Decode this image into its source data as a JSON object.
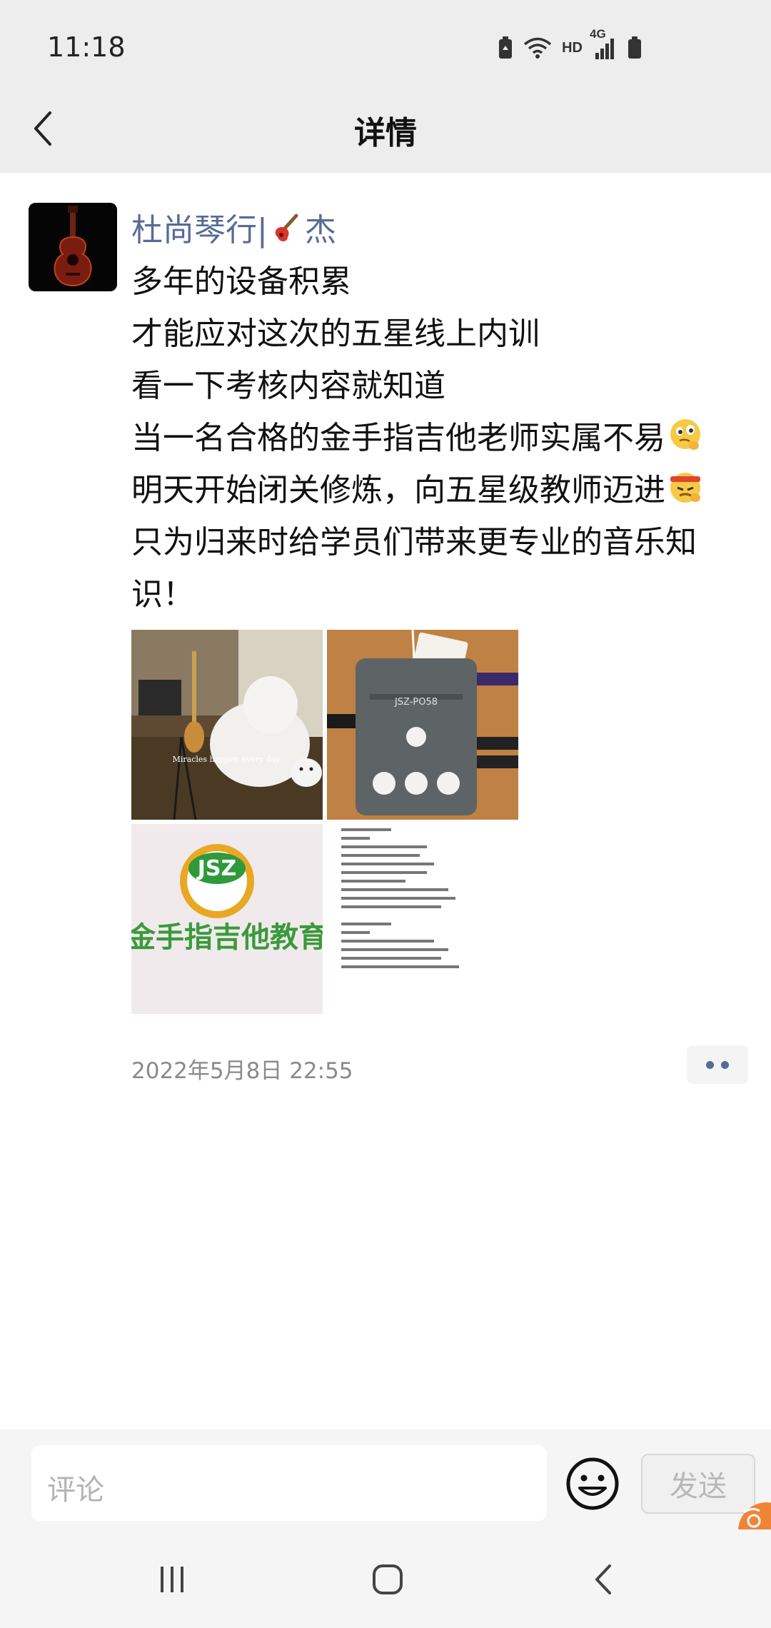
{
  "status": {
    "time": "11:18",
    "network_label": "HD",
    "signal_label": "4G",
    "icons": [
      "battery-saver-icon",
      "wifi-icon",
      "cellular-signal-icon",
      "battery-icon"
    ]
  },
  "nav": {
    "title": "详情",
    "back_icon": "chevron-left-icon"
  },
  "post": {
    "author_prefix": "杜尚琴行|",
    "author_emoji": "guitar-emoji",
    "author_suffix": "杰",
    "lines": [
      "多年的设备积累",
      "才能应对这次的五星线上内训",
      "看一下考核内容就知道",
      "当一名合格的金手指吉他老师实属不易",
      "明天开始闭关修炼，向五星级教师迈进",
      "只为归来时给学员们带来更专业的音乐知",
      "识！"
    ],
    "line4_emoji": "thinking-face-emoji",
    "line5_emoji": "determined-face-emoji",
    "images": [
      {
        "name": "studio-photo",
        "caption": "Miracles happen every day."
      },
      {
        "name": "audio-interface-photo",
        "device_label": "JSZ-PO58"
      },
      {
        "name": "jsz-logo-photo",
        "logo_text": "JSZ",
        "sign_text": "金手指吉他教育"
      },
      {
        "name": "exam-content-photo"
      }
    ],
    "timestamp": "2022年5月8日 22:55",
    "more_icon": "more-dots-icon"
  },
  "comment_bar": {
    "placeholder": "评论",
    "emoji_icon": "smiley-icon",
    "send_label": "发送"
  },
  "system_nav": {
    "icons": [
      "recent-apps-icon",
      "home-icon",
      "back-icon"
    ]
  },
  "colors": {
    "link": "#576b95",
    "header_bg": "#ededed",
    "accent_badge": "#f08436"
  }
}
